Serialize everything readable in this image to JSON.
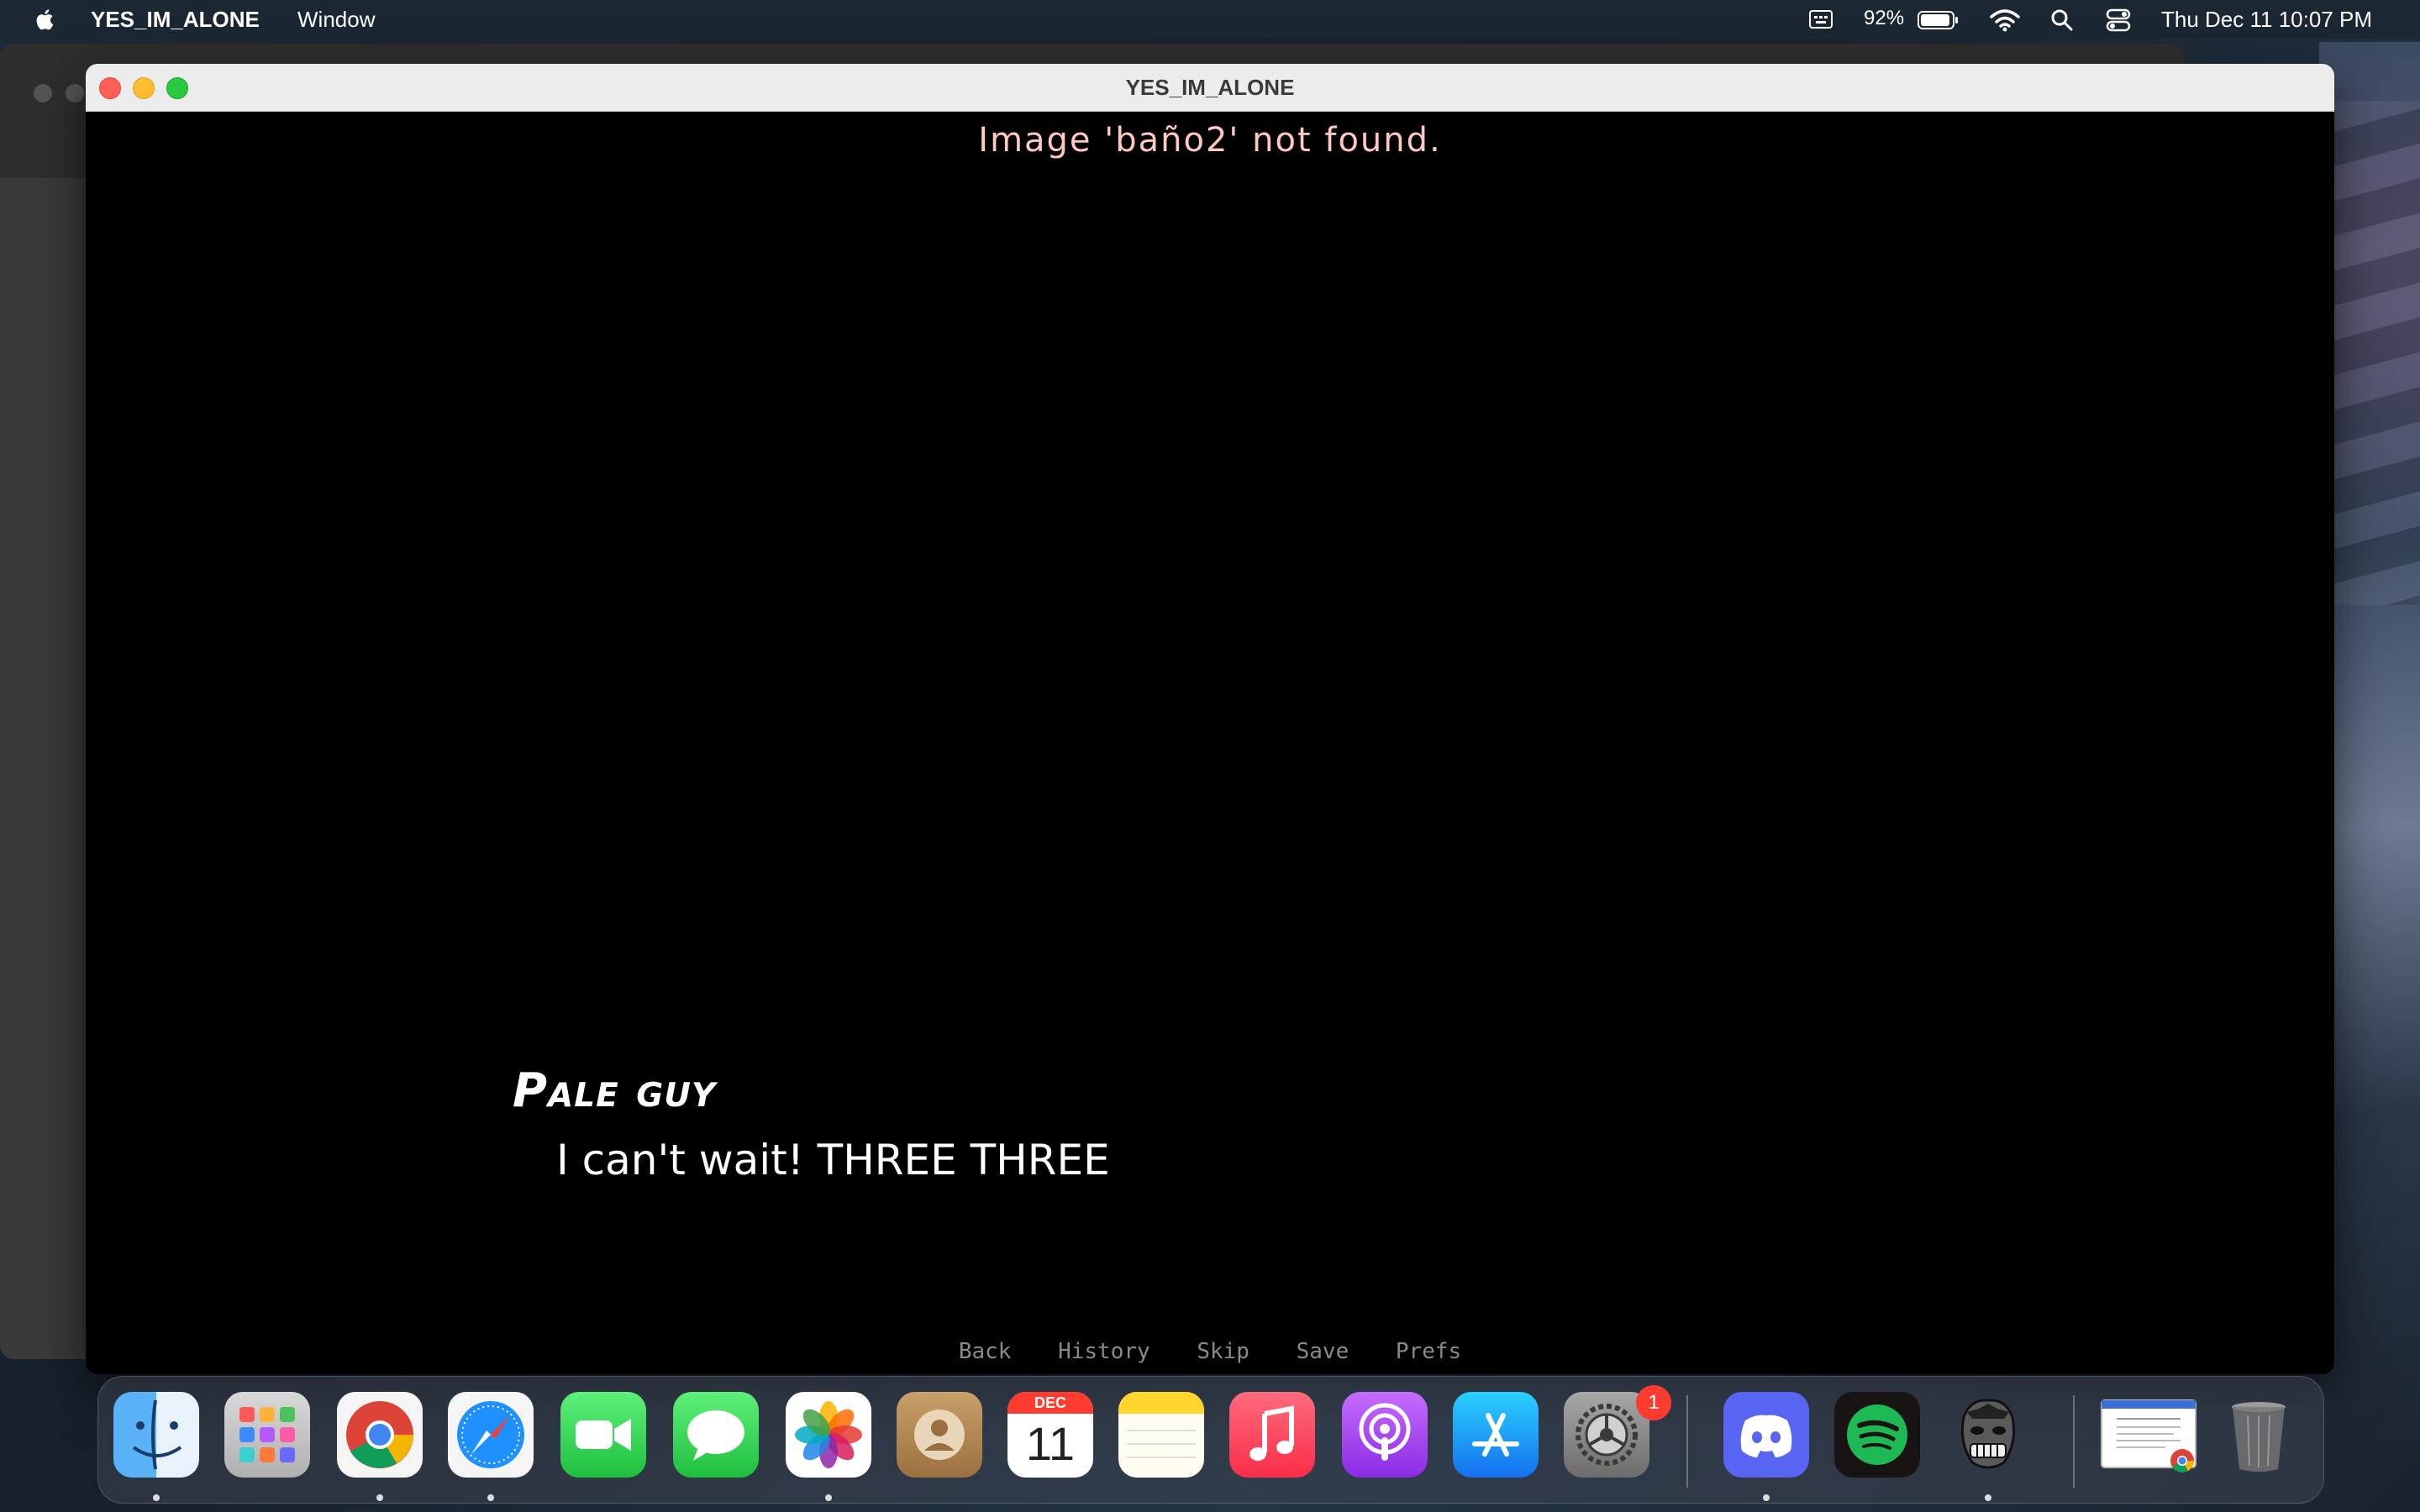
{
  "menubar": {
    "app_name": "YES_IM_ALONE",
    "menu_window": "Window",
    "battery": "92%",
    "datetime": "Thu Dec 11  10:07 PM"
  },
  "window": {
    "title": "YES_IM_ALONE",
    "error_message": "Image 'baño2' not found.",
    "speaker": "Pale guy",
    "dialogue": "I can't wait! THREE THREE",
    "quick_menu": [
      "Back",
      "History",
      "Skip",
      "Save",
      "Prefs"
    ]
  },
  "dock": {
    "calendar_month": "DEC",
    "calendar_day": "11",
    "settings_badge": "1",
    "apps": [
      "finder-icon",
      "launchpad-icon",
      "chrome-icon",
      "safari-icon",
      "facetime-icon",
      "messages-icon",
      "photos-icon",
      "contacts-icon",
      "calendar-icon",
      "notes-icon",
      "music-icon",
      "podcasts-icon",
      "app-store-icon",
      "system-settings-icon",
      "discord-icon",
      "spotify-icon",
      "game-icon",
      "document-thumbnail-icon",
      "trash-icon"
    ]
  },
  "colors": {
    "close": "#fe5f57",
    "minimize": "#febc2e",
    "maximize": "#28c840",
    "error_text": "#ffc8c0"
  }
}
